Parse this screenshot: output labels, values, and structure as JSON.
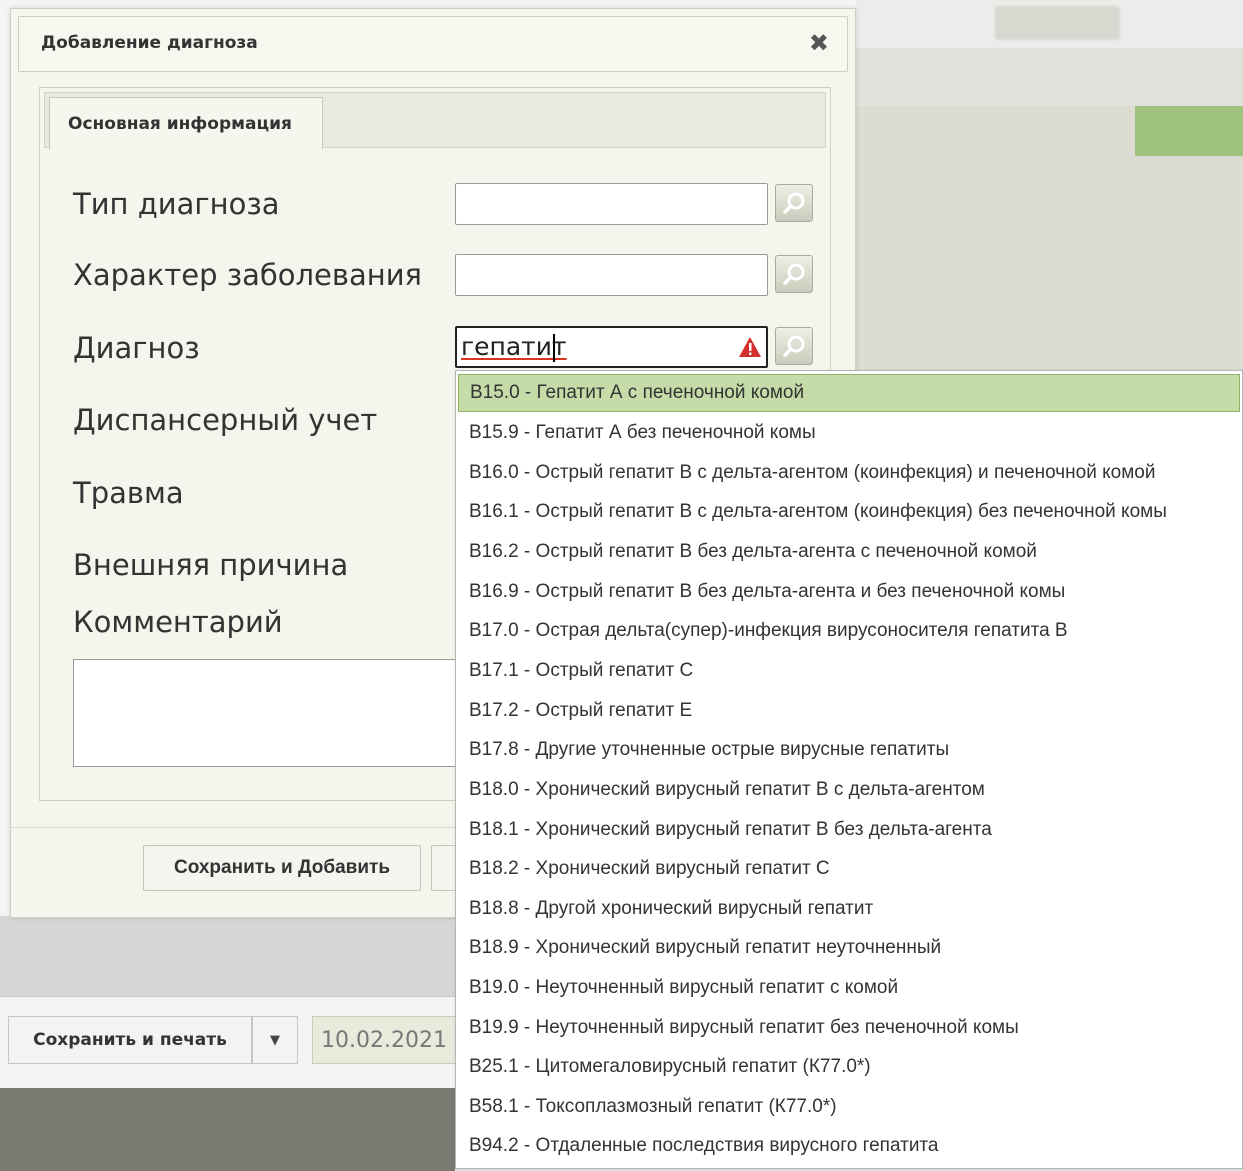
{
  "dialog": {
    "title": "Добавление диагноза",
    "tab_label": "Основная информация",
    "fields": {
      "diagnosis_type": "Тип диагноза",
      "disease_character": "Характер заболевания",
      "diagnosis": "Диагноз",
      "dispensary": "Диспансерный учет",
      "trauma": "Травма",
      "external_cause": "Внешняя причина",
      "comment": "Комментарий"
    },
    "diagnosis_input_value": "гепатит",
    "save_add_label": "Сохранить и Добавить"
  },
  "background": {
    "save_print_label": "Сохранить и печать",
    "date_value": "10.02.2021"
  },
  "suggestions": [
    "B15.0 - Гепатит А с печеночной комой",
    "B15.9 - Гепатит А без печеночной комы",
    "B16.0 - Острый гепатит В с дельта-агентом (коинфекция) и печеночной комой",
    "B16.1 - Острый гепатит В с дельта-агентом (коинфекция) без печеночной комы",
    "B16.2 - Острый гепатит В без дельта-агента с печеночной комой",
    "B16.9 - Острый гепатит В без дельта-агента и без печеночной комы",
    "B17.0 - Острая дельта(супер)-инфекция вирусоносителя гепатита В",
    "B17.1 - Острый гепатит С",
    "B17.2 - Острый гепатит Е",
    "B17.8 - Другие уточненные острые вирусные гепатиты",
    "B18.0 - Хронический вирусный гепатит В с дельта-агентом",
    "B18.1 - Хронический вирусный гепатит В без дельта-агента",
    "B18.2 - Хронический вирусный гепатит С",
    "B18.8 - Другой хронический вирусный гепатит",
    "B18.9 - Хронический вирусный гепатит неуточненный",
    "B19.0 - Неуточненный вирусный гепатит с комой",
    "B19.9 - Неуточненный вирусный гепатит без печеночной комы",
    "B25.1 - Цитомегаловирусный гепатит (К77.0*)",
    "B58.1 - Токсоплазмозный гепатит (К77.0*)",
    "B94.2 - Отдаленные последствия вирусного гепатита"
  ],
  "colors": {
    "selected_suggestion": "#c5dca8",
    "dialog_background": "#f5f5ed",
    "warning": "#d32f2f"
  },
  "icons": [
    "close-icon",
    "search-icon",
    "warning-icon",
    "chevron-down-icon"
  ]
}
